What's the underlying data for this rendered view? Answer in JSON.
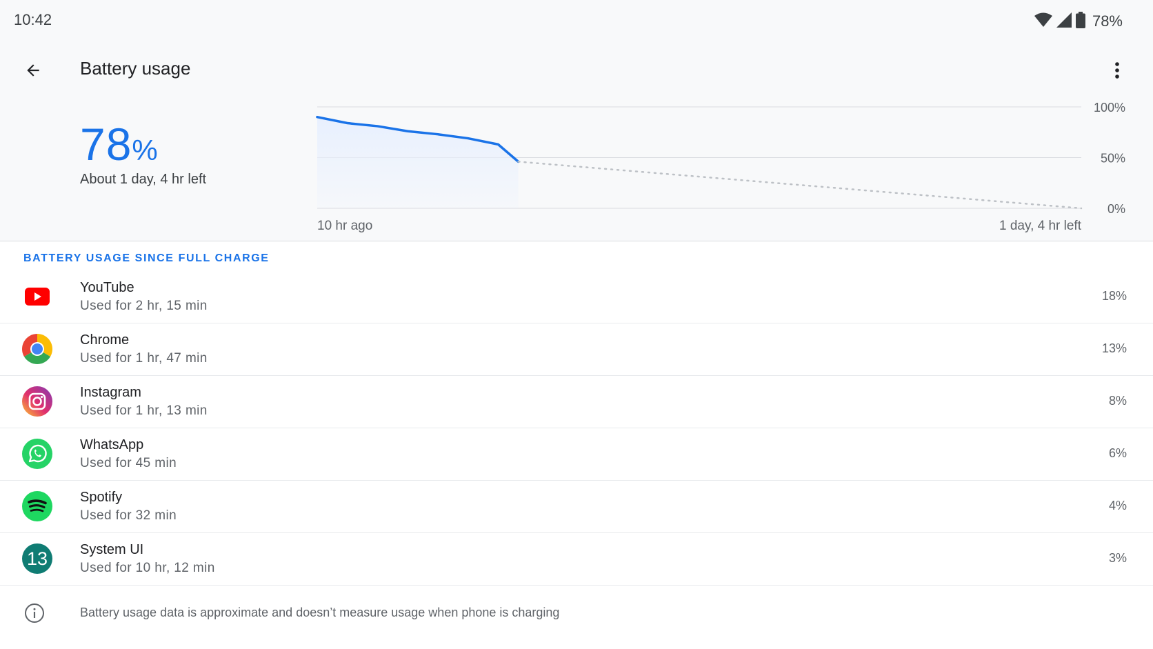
{
  "status_bar": {
    "time": "10:42",
    "battery_text": "78%",
    "icons": [
      "wifi-icon",
      "cell-signal-icon",
      "battery-icon"
    ]
  },
  "app_bar": {
    "title": "Battery usage",
    "back_icon": "arrow-back-icon",
    "more_icon": "more-vert-icon"
  },
  "summary": {
    "percent_value": "78",
    "percent_unit": "%",
    "time_left": "About 1 day, 4 hr left"
  },
  "chart_data": {
    "type": "area",
    "y_tick_labels": [
      "100%",
      "50%",
      "0%"
    ],
    "x_start_label": "10 hr ago",
    "x_end_label": "1 day, 4 hr left",
    "ylim": [
      0,
      100
    ],
    "xlim": [
      0,
      38
    ],
    "x_unit": "hours",
    "actual": {
      "x": [
        0,
        1.5,
        3,
        4.5,
        6,
        7.5,
        9,
        10
      ],
      "y": [
        90,
        84,
        81,
        76,
        73,
        69,
        63,
        46
      ]
    },
    "projected": {
      "x": [
        10,
        38
      ],
      "y": [
        46,
        0
      ]
    },
    "colors": {
      "line": "#1a73e8",
      "fill": "#e8f0fe",
      "projection": "#bdc1c6",
      "grid": "#dadce0"
    }
  },
  "section_title": "BATTERY USAGE SINCE FULL CHARGE",
  "apps": [
    {
      "name": "YouTube",
      "usage": "Used for 2 hr, 15 min",
      "percent": "18%",
      "icon": "youtube-icon"
    },
    {
      "name": "Chrome",
      "usage": "Used for 1 hr, 47 min",
      "percent": "13%",
      "icon": "chrome-icon"
    },
    {
      "name": "Instagram",
      "usage": "Used for 1 hr, 13 min",
      "percent": "8%",
      "icon": "instagram-icon"
    },
    {
      "name": "WhatsApp",
      "usage": "Used for 45 min",
      "percent": "6%",
      "icon": "whatsapp-icon"
    },
    {
      "name": "Spotify",
      "usage": "Used for 32 min",
      "percent": "4%",
      "icon": "spotify-icon"
    },
    {
      "name": "System UI",
      "usage": "Used for 10 hr, 12 min",
      "percent": "3%",
      "icon": "system-ui-icon",
      "icon_text": "13"
    }
  ],
  "footer": {
    "icon": "info-icon",
    "text": "Battery usage data is approximate and doesn’t measure usage when phone is charging"
  },
  "colors": {
    "accent": "#1a73e8",
    "background_top": "#f8f9fa"
  }
}
